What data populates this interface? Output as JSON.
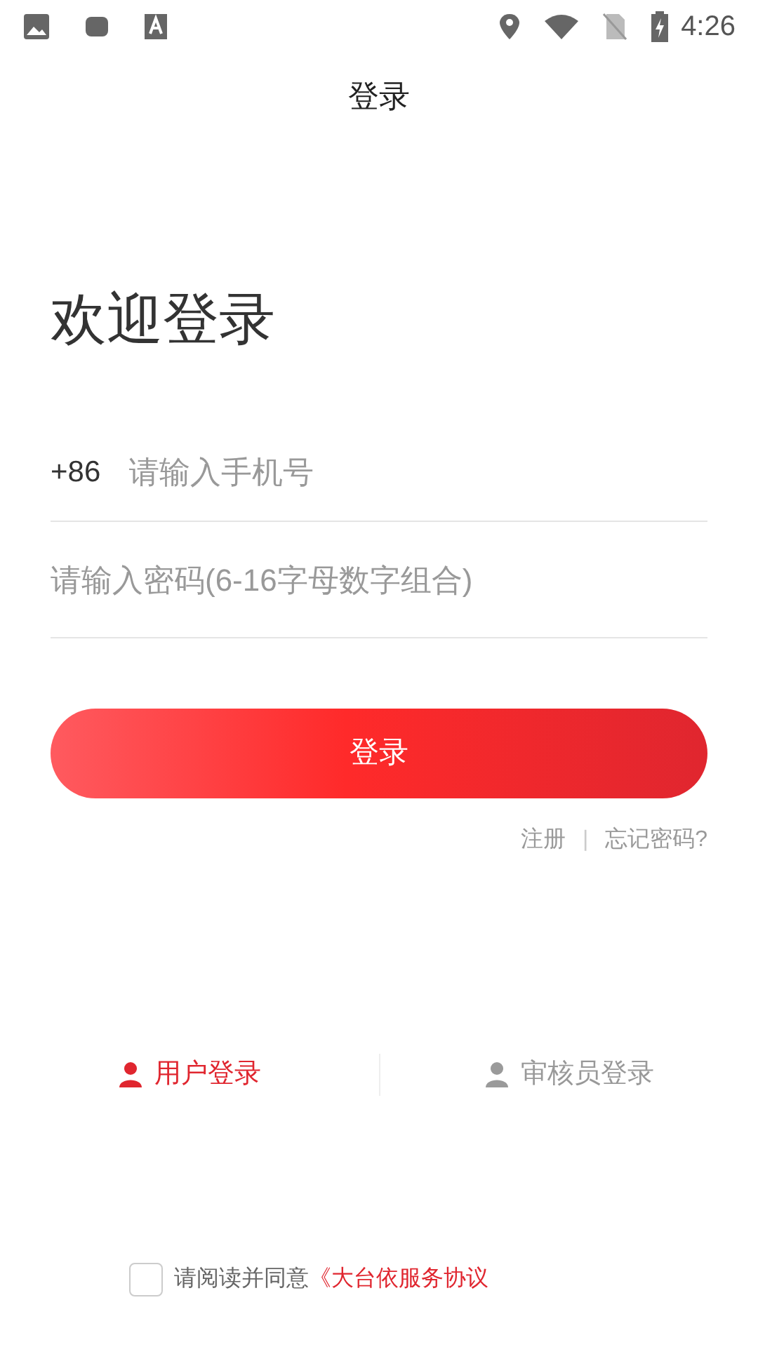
{
  "status_bar": {
    "time": "4:26"
  },
  "header": {
    "title": "登录"
  },
  "welcome": "欢迎登录",
  "phone": {
    "prefix": "+86",
    "placeholder": "请输入手机号"
  },
  "password": {
    "placeholder": "请输入密码(6-16字母数字组合)"
  },
  "login_button": "登录",
  "links": {
    "register": "注册",
    "separator": "|",
    "forgot": "忘记密码?"
  },
  "roles": [
    {
      "label": "用户登录",
      "selected": true
    },
    {
      "label": "审核员登录",
      "selected": false
    }
  ],
  "agreement": {
    "checked": false,
    "text": "请阅读并同意",
    "link": "《大台依服务协议"
  }
}
